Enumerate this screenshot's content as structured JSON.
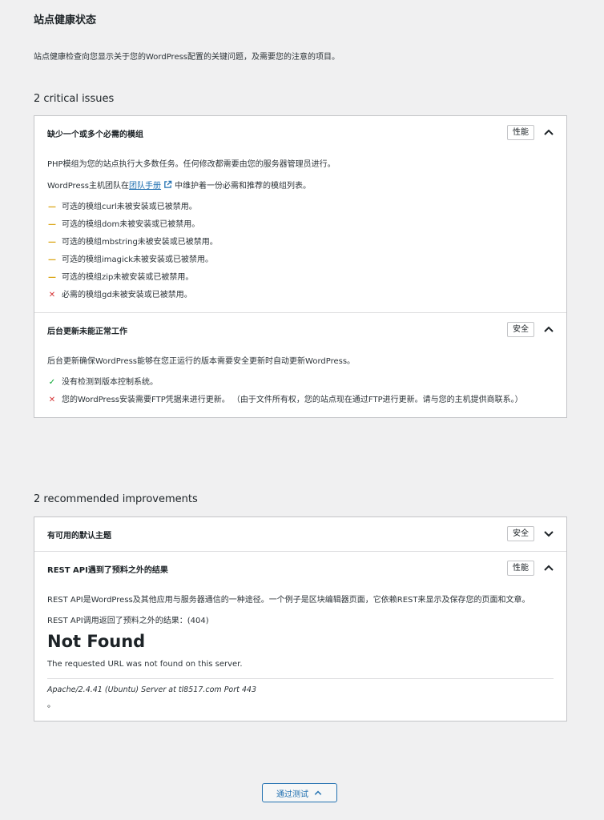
{
  "page": {
    "title": "站点健康状态",
    "intro": "站点健康检查向您显示关于您的WordPress配置的关键问题，及需要您的注意的项目。"
  },
  "critical": {
    "heading": "2 critical issues",
    "issues": [
      {
        "title": "缺少一个或多个必需的模组",
        "badge": "性能",
        "p1": "PHP模组为您的站点执行大多数任务。任何修改都需要由您的服务器管理员进行。",
        "p2_before": "WordPress主机团队在",
        "p2_link": "团队手册",
        "p2_after": "中维护着一份必需和推荐的模组列表。",
        "items": [
          {
            "status": "warning",
            "text": "可选的模组curl未被安装或已被禁用。"
          },
          {
            "status": "warning",
            "text": "可选的模组dom未被安装或已被禁用。"
          },
          {
            "status": "warning",
            "text": "可选的模组mbstring未被安装或已被禁用。"
          },
          {
            "status": "warning",
            "text": "可选的模组imagick未被安装或已被禁用。"
          },
          {
            "status": "warning",
            "text": "可选的模组zip未被安装或已被禁用。"
          },
          {
            "status": "error",
            "text": "必需的模组gd未被安装或已被禁用。"
          }
        ]
      },
      {
        "title": "后台更新未能正常工作",
        "badge": "安全",
        "p1": "后台更新确保WordPress能够在您正运行的版本需要安全更新时自动更新WordPress。",
        "items": [
          {
            "status": "pass",
            "text": "没有检测到版本控制系统。"
          },
          {
            "status": "error",
            "text": "您的WordPress安装需要FTP凭据来进行更新。 （由于文件所有权，您的站点现在通过FTP进行更新。请与您的主机提供商联系。）"
          }
        ]
      }
    ]
  },
  "recommended": {
    "heading": "2 recommended improvements",
    "issues": [
      {
        "title": "有可用的默认主题",
        "badge": "安全"
      },
      {
        "title": "REST API遇到了预料之外的结果",
        "badge": "性能",
        "p1": "REST API是WordPress及其他应用与服务器通信的一种途径。一个例子是区块编辑器页面，它依赖REST来显示及保存您的页面和文章。",
        "p2": "REST API调用返回了预料之外的结果：(404)",
        "nf_title": "Not Found",
        "nf_text": "The requested URL was not found on this server.",
        "server": "Apache/2.4.41 (Ubuntu) Server at tl8517.com Port 443",
        "tail": "。"
      }
    ]
  },
  "footer": {
    "passed_label": "通过测试"
  },
  "icons": {
    "warning": "dash-icon",
    "error": "x-icon",
    "pass": "check-icon"
  },
  "colors": {
    "warning": "#dba617",
    "error": "#d63638",
    "pass": "#00a32a",
    "link": "#2271b1"
  }
}
